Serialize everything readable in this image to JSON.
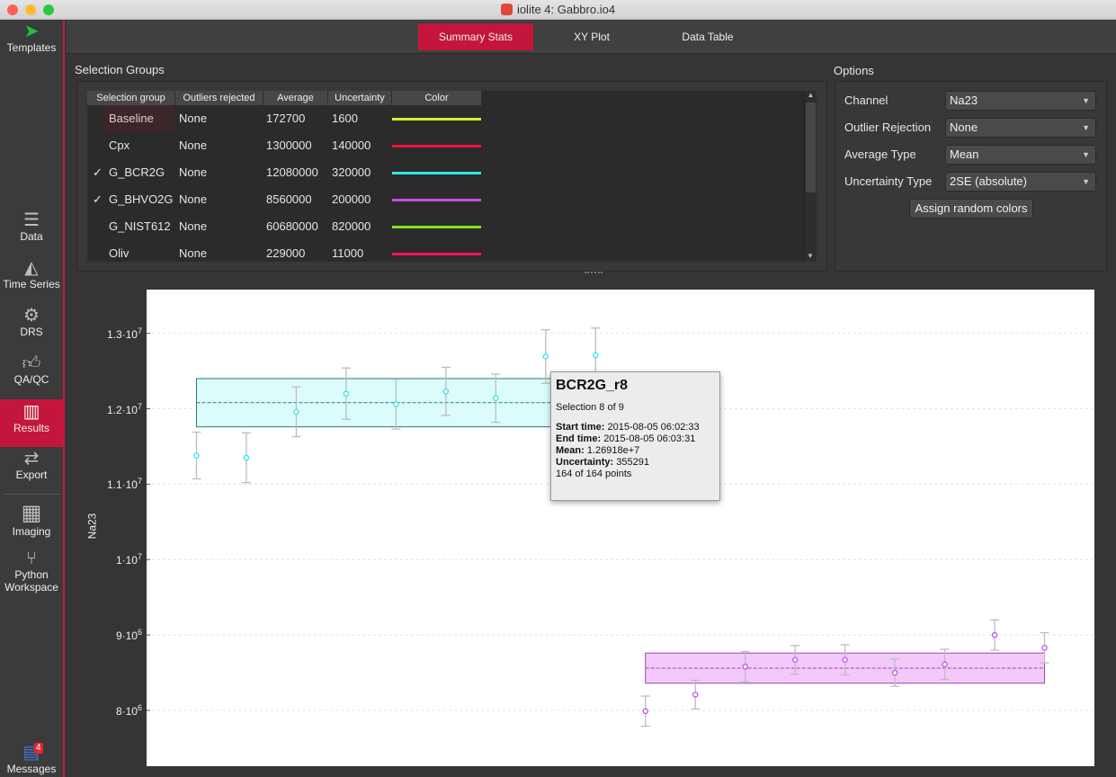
{
  "window": {
    "title": "iolite 4: Gabbro.io4"
  },
  "sidebar": {
    "items": [
      {
        "label": "Templates",
        "icon": "paper-plane-icon"
      },
      {
        "label": "Data",
        "icon": "database-icon"
      },
      {
        "label": "Time Series",
        "icon": "area-chart-icon"
      },
      {
        "label": "DRS",
        "icon": "gear-icon"
      },
      {
        "label": "QA/QC",
        "icon": "thumbs-up-icon"
      },
      {
        "label": "Results",
        "icon": "bar-chart-icon",
        "active": true
      },
      {
        "label": "Export",
        "icon": "arrows-exchange-icon"
      },
      {
        "label": "Imaging",
        "icon": "map-icon"
      },
      {
        "label": "Python Workspace",
        "icon": "branch-icon"
      },
      {
        "label": "Messages",
        "icon": "messages-icon",
        "badge": "4"
      }
    ],
    "active_color": "#c4163c"
  },
  "tabs": [
    {
      "label": "Summary Stats",
      "active": true
    },
    {
      "label": "XY Plot"
    },
    {
      "label": "Data Table"
    }
  ],
  "selection_groups": {
    "title": "Selection Groups",
    "columns": [
      "Selection group",
      "Outliers rejected",
      "Average",
      "Uncertainty",
      "Color"
    ],
    "rows": [
      {
        "checked": false,
        "name": "Baseline",
        "outliers": "None",
        "average": "172700",
        "uncertainty": "1600",
        "color": "#d7f02a"
      },
      {
        "checked": false,
        "name": "Cpx",
        "outliers": "None",
        "average": "1300000",
        "uncertainty": "140000",
        "color": "#f0123c"
      },
      {
        "checked": true,
        "name": "G_BCR2G",
        "outliers": "None",
        "average": "12080000",
        "uncertainty": "320000",
        "color": "#2ee6e6"
      },
      {
        "checked": true,
        "name": "G_BHVO2G",
        "outliers": "None",
        "average": "8560000",
        "uncertainty": "200000",
        "color": "#c44ee6"
      },
      {
        "checked": false,
        "name": "G_NIST612",
        "outliers": "None",
        "average": "60680000",
        "uncertainty": "820000",
        "color": "#7ae61e"
      },
      {
        "checked": false,
        "name": "Oliv",
        "outliers": "None",
        "average": "229000",
        "uncertainty": "11000",
        "color": "#f01464"
      }
    ],
    "check_mark": "✓"
  },
  "options": {
    "title": "Options",
    "channel": {
      "label": "Channel",
      "value": "Na23"
    },
    "outlier_rejection": {
      "label": "Outlier Rejection",
      "value": "None"
    },
    "average_type": {
      "label": "Average Type",
      "value": "Mean"
    },
    "uncertainty_type": {
      "label": "Uncertainty Type",
      "value": "2SE (absolute)"
    },
    "assign_button": "Assign random colors"
  },
  "tooltip": {
    "title": "BCR2G_r8",
    "selection": "Selection 8 of 9",
    "start_label": "Start time:",
    "start": "2015-08-05 06:02:33",
    "end_label": "End time:",
    "end": "2015-08-05 06:03:31",
    "mean_label": "Mean:",
    "mean": "1.26918e+7",
    "unc_label": "Uncertainty:",
    "unc": "355291",
    "points": "164 of 164 points"
  },
  "chart_data": {
    "type": "scatter",
    "ylabel": "Na23",
    "ylim": [
      7260000,
      13580000
    ],
    "xlim": [
      -1,
      18
    ],
    "grid": true,
    "yticks": [
      {
        "value": 13000000,
        "mantissa": "1.3·10",
        "exp": "7"
      },
      {
        "value": 12000000,
        "mantissa": "1.2·10",
        "exp": "7"
      },
      {
        "value": 11000000,
        "mantissa": "1.1·10",
        "exp": "7"
      },
      {
        "value": 10000000,
        "mantissa": "1·10",
        "exp": "7"
      },
      {
        "value": 9000000,
        "mantissa": "9·10",
        "exp": "6"
      },
      {
        "value": 8000000,
        "mantissa": "8·10",
        "exp": "6"
      }
    ],
    "series": [
      {
        "name": "G_BCR2G",
        "color": "#2ee6e6",
        "fill": "#dcfcfc",
        "edge": "#2a7a78",
        "mean": 12080000,
        "uncertainty": 320000,
        "x": [
          0,
          1,
          2,
          3,
          4,
          5,
          6,
          7,
          8
        ],
        "y": [
          11380000,
          11350000,
          11960000,
          12200000,
          12060000,
          12230000,
          12140000,
          12691800,
          12710000
        ],
        "err": [
          310000,
          330000,
          330000,
          340000,
          330000,
          320000,
          320000,
          355291,
          360000
        ]
      },
      {
        "name": "G_BHVO2G",
        "color": "#c44ee6",
        "fill": "#f3c9fb",
        "edge": "#9a4aa8",
        "mean": 8560000,
        "uncertainty": 200000,
        "x": [
          9,
          10,
          11,
          12,
          13,
          14,
          15,
          16,
          17
        ],
        "y": [
          7990000,
          8210000,
          8580000,
          8670000,
          8670000,
          8500000,
          8610000,
          9000000,
          8830000
        ],
        "err": [
          200000,
          190000,
          200000,
          190000,
          200000,
          180000,
          200000,
          200000,
          200000
        ]
      }
    ]
  }
}
